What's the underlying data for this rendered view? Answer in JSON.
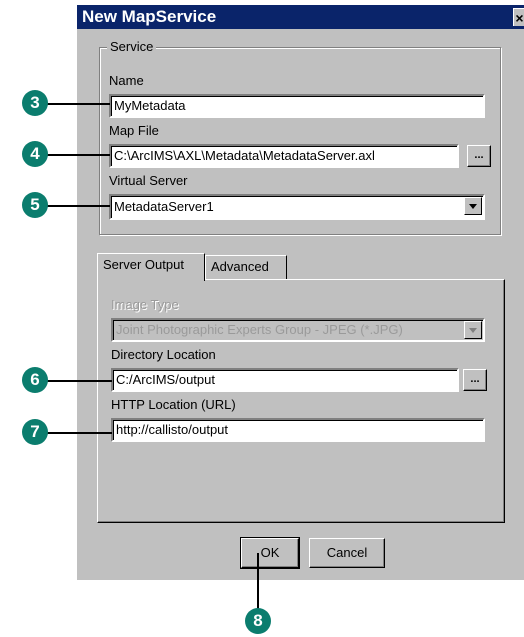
{
  "window": {
    "title": "New MapService",
    "close_glyph": "×"
  },
  "service_group": {
    "legend": "Service",
    "name_label": "Name",
    "name_value": "MyMetadata",
    "map_file_label": "Map File",
    "map_file_value": "C:\\ArcIMS\\AXL\\Metadata\\MetadataServer.axl",
    "browse_label": "...",
    "virtual_server_label": "Virtual Server",
    "virtual_server_value": "MetadataServer1"
  },
  "tabs": [
    {
      "label": "Server Output",
      "active": true
    },
    {
      "label": "Advanced",
      "active": false
    }
  ],
  "server_output": {
    "image_type_label": "Image Type",
    "image_type_value": "Joint Photographic Experts Group - JPEG (*.JPG)",
    "directory_label": "Directory Location",
    "directory_value": "C:/ArcIMS/output",
    "browse_label": "...",
    "http_label": "HTTP Location (URL)",
    "http_value": "http://callisto/output"
  },
  "buttons": {
    "ok": "OK",
    "cancel": "Cancel"
  },
  "callouts": {
    "c3": "3",
    "c4": "4",
    "c5": "5",
    "c6": "6",
    "c7": "7",
    "c8": "8"
  },
  "colors": {
    "titlebar": "#0a246a",
    "dialog_bg": "#c0c0c0",
    "callout": "#0b7d6e"
  }
}
